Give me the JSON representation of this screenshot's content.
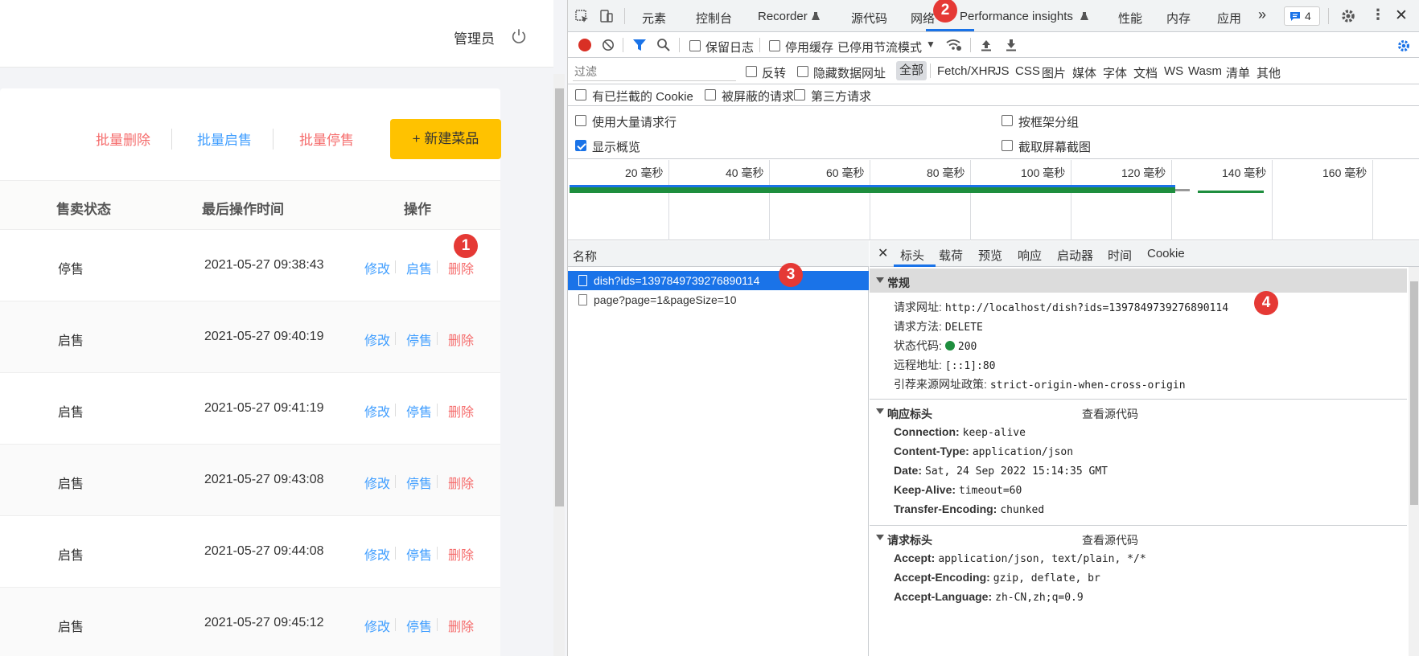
{
  "app": {
    "admin_name": "管理员",
    "batch_actions": {
      "delete": "批量删除",
      "enable": "批量启售",
      "disable": "批量停售",
      "new_dish": "+ 新建菜品"
    },
    "columns": {
      "status": "售卖状态",
      "last_modified": "最后操作时间",
      "actions": "操作"
    },
    "rows": [
      {
        "status": "停售",
        "time": "2021-05-27 09:38:43",
        "edit": "修改",
        "toggle": "启售",
        "delete": "删除"
      },
      {
        "status": "启售",
        "time": "2021-05-27 09:40:19",
        "edit": "修改",
        "toggle": "停售",
        "delete": "删除"
      },
      {
        "status": "启售",
        "time": "2021-05-27 09:41:19",
        "edit": "修改",
        "toggle": "停售",
        "delete": "删除"
      },
      {
        "status": "启售",
        "time": "2021-05-27 09:43:08",
        "edit": "修改",
        "toggle": "停售",
        "delete": "删除"
      },
      {
        "status": "启售",
        "time": "2021-05-27 09:44:08",
        "edit": "修改",
        "toggle": "停售",
        "delete": "删除"
      },
      {
        "status": "启售",
        "time": "2021-05-27 09:45:12",
        "edit": "修改",
        "toggle": "停售",
        "delete": "删除"
      }
    ],
    "colors": {
      "accent": "#ffc200",
      "link": "#409eff",
      "danger": "#f56c6c"
    }
  },
  "badges": [
    "1",
    "2",
    "3",
    "4"
  ],
  "devtools": {
    "tabs": [
      "元素",
      "控制台",
      "Recorder",
      "源代码",
      "网络",
      "Performance insights",
      "性能",
      "内存",
      "应用"
    ],
    "issues_count": "4",
    "toolbar": {
      "preserve_log": "保留日志",
      "disable_cache": "停用缓存",
      "throttling": "已停用节流模式"
    },
    "filter": {
      "placeholder": "过滤",
      "invert": "反转",
      "hide_data_urls": "隐藏数据网址",
      "types": [
        "全部",
        "Fetch/XHR",
        "JS",
        "CSS",
        "图片",
        "媒体",
        "字体",
        "文档",
        "WS",
        "Wasm",
        "清单",
        "其他"
      ]
    },
    "options": {
      "blocked_cookies": "有已拦截的 Cookie",
      "blocked_requests": "被屏蔽的请求",
      "third_party": "第三方请求",
      "big_rows": "使用大量请求行",
      "group_by_frame": "按框架分组",
      "show_overview": "显示概览",
      "capture_screenshots": "截取屏幕截图"
    },
    "overview_ticks": [
      "20 毫秒",
      "40 毫秒",
      "60 毫秒",
      "80 毫秒",
      "100 毫秒",
      "120 毫秒",
      "140 毫秒",
      "160 毫秒"
    ],
    "requests": {
      "header": "名称",
      "items": [
        "dish?ids=1397849739276890114",
        "page?page=1&pageSize=10"
      ]
    },
    "details": {
      "tabs": [
        "标头",
        "载荷",
        "预览",
        "响应",
        "启动器",
        "时间",
        "Cookie"
      ],
      "general": {
        "title": "常规",
        "url_label": "请求网址:",
        "url": "http://localhost/dish?ids=1397849739276890114",
        "method_label": "请求方法:",
        "method": "DELETE",
        "status_label": "状态代码:",
        "status": "200",
        "remote_label": "远程地址:",
        "remote": "[::1]:80",
        "referrer_label": "引荐来源网址政策:",
        "referrer": "strict-origin-when-cross-origin"
      },
      "response_headers": {
        "title": "响应标头",
        "view_source": "查看源代码",
        "items": [
          {
            "k": "Connection:",
            "v": "keep-alive"
          },
          {
            "k": "Content-Type:",
            "v": "application/json"
          },
          {
            "k": "Date:",
            "v": "Sat, 24 Sep 2022 15:14:35 GMT"
          },
          {
            "k": "Keep-Alive:",
            "v": "timeout=60"
          },
          {
            "k": "Transfer-Encoding:",
            "v": "chunked"
          }
        ]
      },
      "request_headers": {
        "title": "请求标头",
        "view_source": "查看源代码",
        "items": [
          {
            "k": "Accept:",
            "v": "application/json, text/plain, */*"
          },
          {
            "k": "Accept-Encoding:",
            "v": "gzip, deflate, br"
          },
          {
            "k": "Accept-Language:",
            "v": "zh-CN,zh;q=0.9"
          }
        ]
      }
    }
  }
}
